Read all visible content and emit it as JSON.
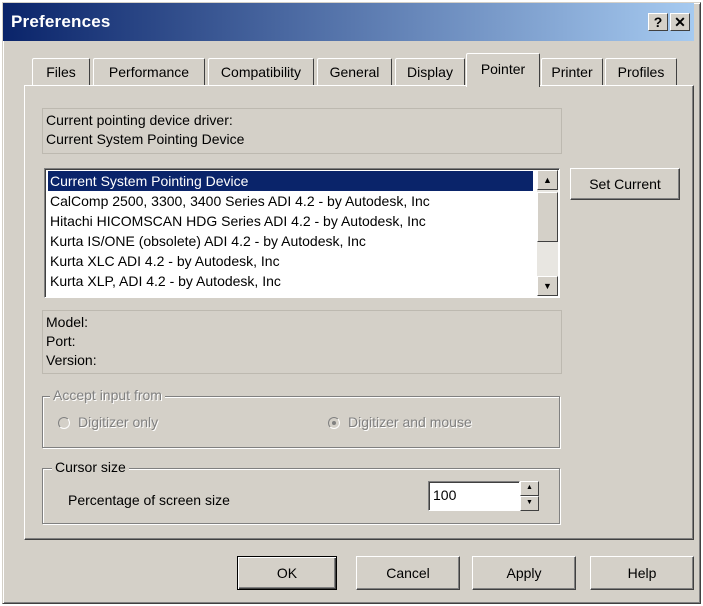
{
  "window": {
    "title": "Preferences",
    "help_glyph": "?",
    "close_glyph": "✕"
  },
  "tabs": [
    {
      "label": "Files"
    },
    {
      "label": "Performance"
    },
    {
      "label": "Compatibility"
    },
    {
      "label": "General"
    },
    {
      "label": "Display"
    },
    {
      "label": "Pointer",
      "active": true
    },
    {
      "label": "Printer"
    },
    {
      "label": "Profiles"
    }
  ],
  "pointer": {
    "current_driver_label": "Current pointing device driver:",
    "current_driver_value": "Current System Pointing Device",
    "devices": [
      "Current System Pointing Device",
      "CalComp 2500, 3300, 3400 Series ADI 4.2 - by Autodesk, Inc",
      "Hitachi HICOMSCAN HDG Series ADI 4.2 - by Autodesk, Inc",
      "Kurta IS/ONE (obsolete) ADI 4.2 - by Autodesk, Inc",
      "Kurta XLC ADI 4.2 - by Autodesk, Inc",
      "Kurta XLP, ADI 4.2 - by Autodesk, Inc"
    ],
    "selected_index": 0,
    "set_current_label": "Set Current",
    "model_label": "Model:",
    "port_label": "Port:",
    "version_label": "Version:",
    "accept_input": {
      "legend": "Accept input from",
      "digitizer_only": "Digitizer only",
      "digitizer_and_mouse": "Digitizer and mouse",
      "selected": "digitizer_and_mouse",
      "enabled": false
    },
    "cursor_size": {
      "legend": "Cursor size",
      "label": "Percentage of screen size",
      "value": "100"
    }
  },
  "buttons": {
    "ok": "OK",
    "cancel": "Cancel",
    "apply": "Apply",
    "help": "Help"
  },
  "colors": {
    "face": "#d4d0c8",
    "title_start": "#0a246a",
    "title_end": "#a6caf0",
    "selection": "#0a246a"
  }
}
